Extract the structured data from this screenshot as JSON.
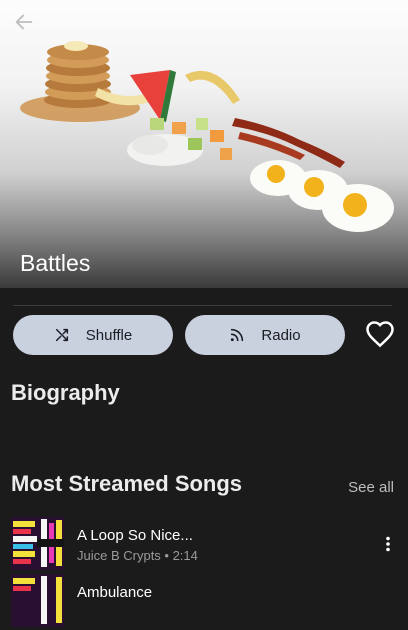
{
  "artist": {
    "name": "Battles"
  },
  "actions": {
    "shuffle_label": "Shuffle",
    "radio_label": "Radio"
  },
  "biography": {
    "title": "Biography"
  },
  "most_streamed": {
    "title": "Most Streamed Songs",
    "see_all_label": "See all",
    "songs": [
      {
        "title": "A Loop So Nice...",
        "artist": "Juice B Crypts",
        "duration": "2:14",
        "meta": "Juice B Crypts • 2:14"
      },
      {
        "title": "Ambulance"
      }
    ]
  },
  "icons": {
    "back": "arrow-left-icon",
    "shuffle": "shuffle-icon",
    "radio": "radio-icon",
    "favorite": "heart-outline-icon",
    "more": "more-vertical-icon"
  },
  "colors": {
    "background": "#1b1b1c",
    "pill": "#c9d0de",
    "pill_text": "#1b1d24",
    "secondary_text": "#9a9a9a"
  }
}
